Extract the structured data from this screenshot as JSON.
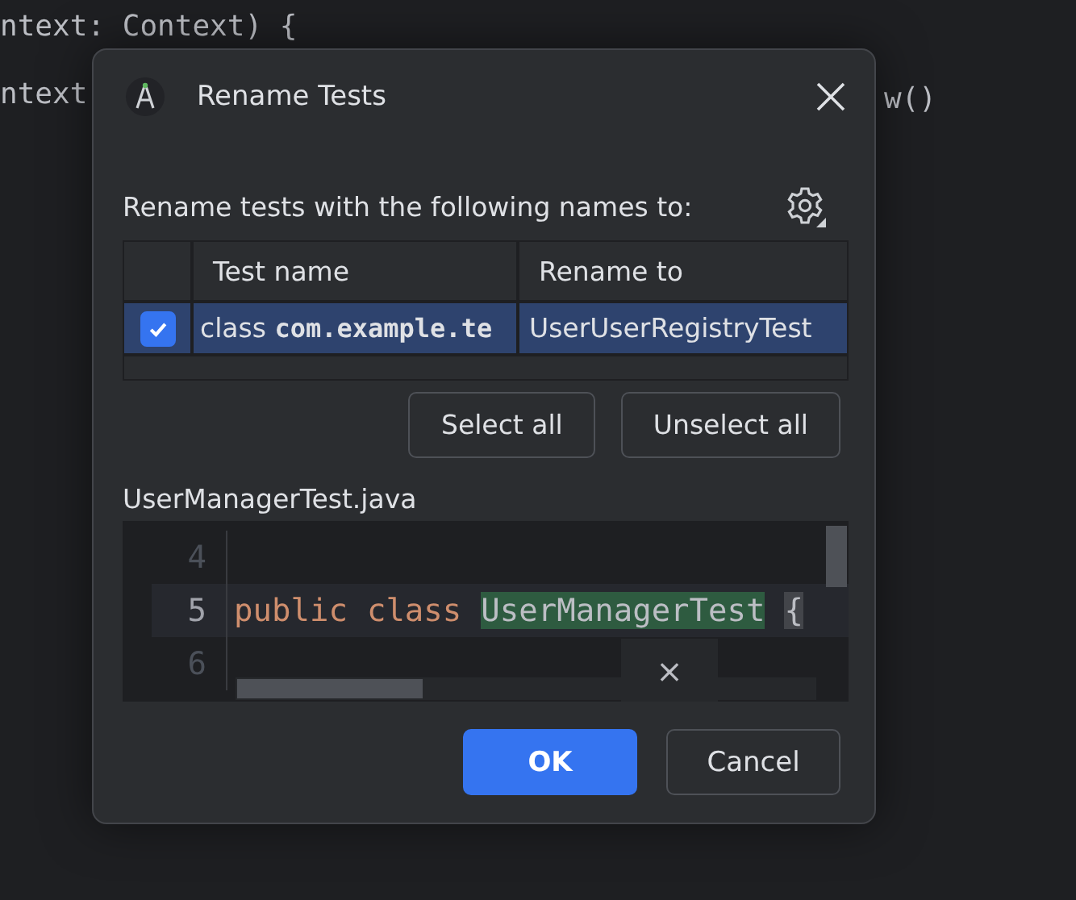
{
  "background_code": {
    "lines": [
      "ntext: Context) {",
      "ntext"
    ],
    "right_fragment": "w()"
  },
  "dialog": {
    "title": "Rename Tests",
    "prompt": "Rename tests with the following names to:",
    "table": {
      "columns": [
        "Test name",
        "Rename to"
      ],
      "rows": [
        {
          "checked": true,
          "selected": true,
          "test_name": "class **com.example.te**",
          "rename_to": "UserUserRegistryTest"
        }
      ]
    },
    "table_buttons": [
      "Select all",
      "Unselect all"
    ],
    "file_name": "UserManagerTest.java",
    "preview": {
      "lines": [
        {
          "number": "4",
          "current": false
        },
        {
          "number": "5",
          "current": true,
          "tokens": [
            {
              "kind": "keyword",
              "text": "public"
            },
            {
              "kind": "keyword",
              "text": "class"
            },
            {
              "kind": "highlight",
              "text": "UserManagerTest"
            },
            {
              "kind": "brace",
              "text": "{"
            }
          ]
        },
        {
          "number": "6",
          "current": false
        }
      ],
      "close_overlay": "×"
    },
    "buttons": [
      {
        "label": "OK",
        "kind": "primary"
      },
      {
        "label": "Cancel",
        "kind": "secondary"
      }
    ]
  }
}
